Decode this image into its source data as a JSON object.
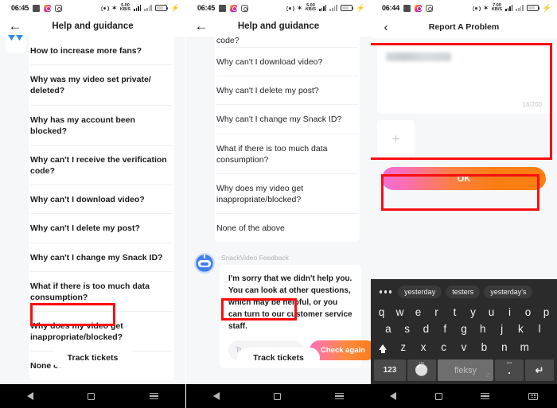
{
  "panel1": {
    "statusbar": {
      "time": "06:45",
      "data_rate": "5.00",
      "data_unit": "KB/S",
      "icons": [
        "messenger-icon",
        "instagram-icon",
        "camera-icon",
        "gps-icon",
        "bluetooth-icon",
        "signal-bars-icon",
        "wifi-icon",
        "battery-icon",
        "charging-bolt-icon"
      ]
    },
    "appbar": {
      "title": "Help and guidance",
      "back": "←"
    },
    "items": [
      "How to increase more fans?",
      "Why was my video set private/ deleted?",
      "Why has my account been blocked?",
      "Why can't I receive the verification code?",
      "Why can't I download video?",
      "Why can't I delete my post?",
      "Why can't I change my Snack ID?",
      "What if there is too much data consumption?",
      "Why does my video get inappropriate/blocked?",
      "None of the above"
    ],
    "track_button": "Track tickets"
  },
  "panel2": {
    "statusbar": {
      "time": "06:45",
      "data_rate": "5.00",
      "data_unit": "KB/S"
    },
    "appbar": {
      "title": "Help and guidance",
      "back": "←"
    },
    "clipped_item": "code?",
    "items": [
      "Why can't I download video?",
      "Why can't I delete my post?",
      "Why can't I change my Snack ID?",
      "What if there is too much data consumption?",
      "Why does my video get inappropriate/blocked?",
      "None of the above"
    ],
    "chat": {
      "bot_name": "SnackVideo Feedback",
      "message": "I'm sorry that we didn't help you. You can look at other questions, which may be helpful, or you can turn to our customer service staff.",
      "ghost_button": "Turn to custom...",
      "grad_button": "Check again"
    },
    "track_button": "Track tickets"
  },
  "panel3": {
    "statusbar": {
      "time": "06:44",
      "data_rate": "7.00",
      "data_unit": "KB/S"
    },
    "appbar": {
      "title": "Report A Problem",
      "back": "‹"
    },
    "textarea": {
      "value_redacted": "",
      "counter": "16/200"
    },
    "add_attachment": "+",
    "ok_button": "OK",
    "keyboard": {
      "suggestions": [
        "yesterday",
        "testers",
        "yesterday's"
      ],
      "row1": [
        "q",
        "w",
        "e",
        "r",
        "t",
        "y",
        "u",
        "i",
        "o",
        "p"
      ],
      "row2": [
        "a",
        "s",
        "d",
        "f",
        "g",
        "h",
        "j",
        "k",
        "l"
      ],
      "row3": [
        "z",
        "x",
        "c",
        "v",
        "b",
        "n",
        "m"
      ],
      "num_key": "123",
      "spacebar": "fleksy",
      "period_key": ".",
      "enter_key": "↵",
      "shift_key": "shift-icon",
      "backspace_key": "backspace-icon",
      "fleksy_logo_key": "fleksy-logo-icon"
    }
  },
  "navbar": {
    "back": "nav-back-icon",
    "home": "nav-home-icon",
    "recents": "nav-recents-icon",
    "keyboard": "nav-keyboard-icon"
  },
  "annotations": {
    "highlight_color": "#fc0d10"
  }
}
